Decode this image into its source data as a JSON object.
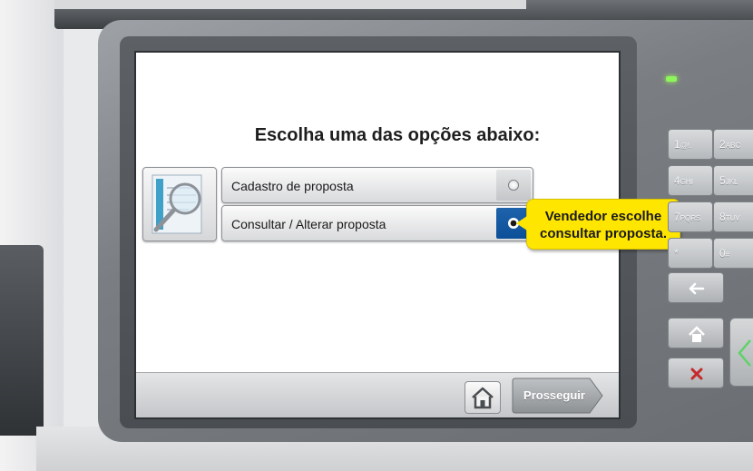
{
  "screen": {
    "title": "Escolha uma das opções abaixo:",
    "options": [
      {
        "label": "Cadastro de proposta",
        "selected": false
      },
      {
        "label": "Consultar / Alterar proposta",
        "selected": true
      }
    ],
    "home_icon": "home-icon",
    "next_label": "Prosseguir"
  },
  "callout": {
    "line1": "Vendedor escolhe",
    "line2": "consultar proposta."
  },
  "keypad": {
    "keys": [
      {
        "label": "1",
        "sub": "@!."
      },
      {
        "label": "2",
        "sub": "ABC"
      },
      {
        "label": "4",
        "sub": "GHI"
      },
      {
        "label": "5",
        "sub": "JKL"
      },
      {
        "label": "7",
        "sub": "PQRS"
      },
      {
        "label": "8",
        "sub": "TUV"
      },
      {
        "label": "*",
        "sub": ""
      },
      {
        "label": "0",
        "sub": "#"
      }
    ],
    "back_icon": "arrow-left-icon",
    "home_icon": "home-icon",
    "cancel_icon": "x-icon"
  },
  "colors": {
    "callout_bg": "#ffe600",
    "selected_radio_bg": "#0b4f98",
    "led": "#8ef55a",
    "cancel": "#c62a2a"
  }
}
